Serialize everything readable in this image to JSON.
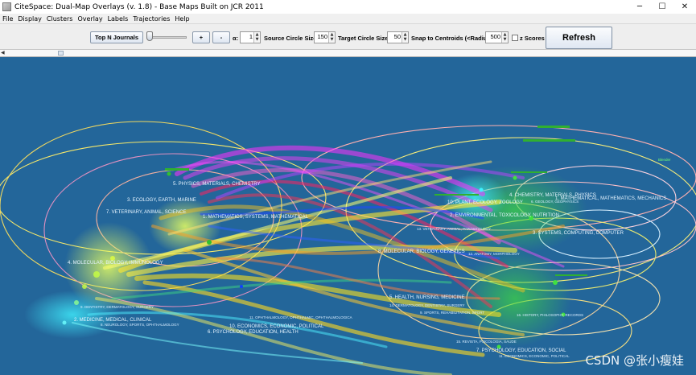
{
  "window": {
    "title": "CiteSpace: Dual-Map Overlays (v. 1.8) - Base Maps Built on JCR 2011",
    "minimize": "─",
    "maximize": "☐",
    "close": "✕"
  },
  "menu": [
    "File",
    "Display",
    "Clusters",
    "Overlay",
    "Labels",
    "Trajectories",
    "Help"
  ],
  "toolbar": {
    "top_n_label": "Top N Journals",
    "plus_label": "+",
    "minus_label": "-",
    "alpha_label": "α:",
    "alpha_value": "1",
    "source_label": "Source Circle Size:",
    "source_value": "150",
    "target_label": "Target Circle Size:",
    "target_value": "50",
    "snap_label": "Snap to Centroids (<Radius):",
    "snap_value": "500",
    "zscores_label": "z Scores",
    "zscores_checked": false,
    "refresh_label": "Refresh"
  },
  "map": {
    "background": "#23669a",
    "left_labels": [
      "5. PHYSICS, MATERIALS, CHEMISTRY",
      "3. ECOLOGY, EARTH, MARINE",
      "7. VETERINARY, ANIMAL, SCIENCE",
      "1. MATHEMATICS, SYSTEMS, MATHEMATICAL",
      "4. MOLECULAR, BIOLOGY, IMMUNOLOGY",
      "9. DENTISTRY, DERMATOLOGY, SURGERY",
      "2. MEDICINE, MEDICAL, CLINICAL",
      "8. NEUROLOGY, SPORTS, OPHTHALMOLOGY",
      "11. OPHTHALMOLOGY, OPHTHALMIC, OPHTHALMOLOGICA",
      "10. ECONOMICS, ECONOMIC, POLITICAL",
      "6. PSYCHOLOGY, EDUCATION, HEALTH"
    ],
    "right_labels": [
      "4. CHEMISTRY, MATERIALS, PHYSICS",
      "1. MATHEMATICAL, MATHEMATICS, MECHANICS",
      "10. PLANT, ECOLOGY, ZOOLOGY",
      "2. ENVIRONMENTAL, TOXICOLOGY, NUTRITION",
      "13. VETERINARY, ANIMAL, PARASITOLOGY",
      "3. SYSTEMS, COMPUTING, COMPUTER",
      "8. MOLECULAR, BIOLOGY, GENETICS",
      "5. HEALTH, NURSING, MEDICINE",
      "14. DERMATOLOGY, DENTISTRY, SURGERY",
      "9. SPORTS, REHABILITATION, SPORT",
      "16. HISTORY, PHILOSOPHY, RECORDS",
      "15. REVISTA, PSICOLOGIA, SAUDE",
      "7. PSYCHOLOGY, EDUCATION, SOCIAL",
      "11. ECONOMICS, ECONOMIC, POLITICAL"
    ],
    "minor_labels": [
      "6. GEOLOGY, GEOPHYSICS",
      "12. ANATOMY, MORPHOLOGY",
      "Blender"
    ],
    "watermark": "CSDN @张小瘦娃"
  }
}
